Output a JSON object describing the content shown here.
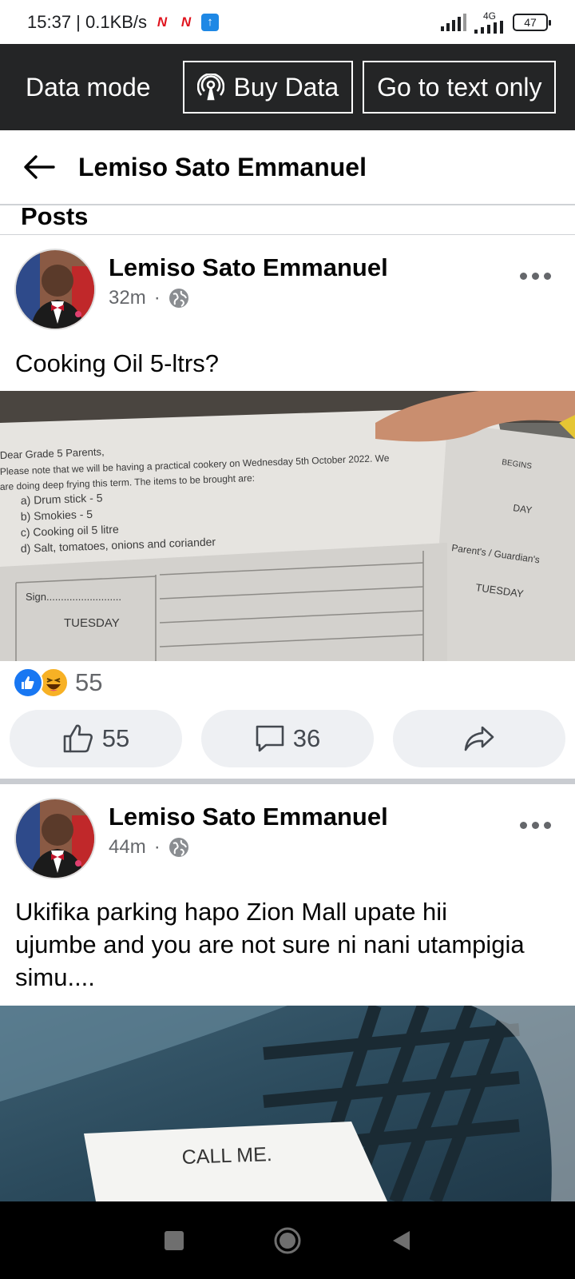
{
  "status_bar": {
    "time_speed": "15:37 | 0.1KB/s",
    "network": "4G",
    "battery": "47"
  },
  "data_bar": {
    "mode_label": "Data mode",
    "buy_data": "Buy Data",
    "text_only": "Go to text only"
  },
  "header": {
    "title": "Lemiso Sato Emmanuel"
  },
  "section_label": "Posts",
  "posts": [
    {
      "author": "Lemiso Sato Emmanuel",
      "time": "32m",
      "text": "Cooking Oil 5-ltrs?",
      "image_text": {
        "line1": "Dear Grade 5 Parents,",
        "line2": "Please note that we will be having a practical cookery on Wednesday 5th October 2022. We",
        "line3": "are doing deep frying this term. The items to be brought are:",
        "item_a": "a)  Drum stick - 5",
        "item_b": "b)  Smokies - 5",
        "item_c": "c)  Cooking oil 5 litre",
        "item_d": "d)  Salt, tomatoes, onions and coriander",
        "sign": "Sign..........................",
        "tuesday": "TUESDAY",
        "parents": "Parent's / Guardian's",
        "tuesday2": "TUESDAY",
        "day": "DAY",
        "begins": "BEGINS"
      },
      "reaction_count": "55",
      "like_count": "55",
      "comment_count": "36"
    },
    {
      "author": "Lemiso Sato Emmanuel",
      "time": "44m",
      "text": "Ukifika parking hapo Zion Mall upate hii ujumbe and you are not sure ni nani utampigia simu....",
      "image_text": {
        "note": "CALL ME."
      }
    }
  ]
}
